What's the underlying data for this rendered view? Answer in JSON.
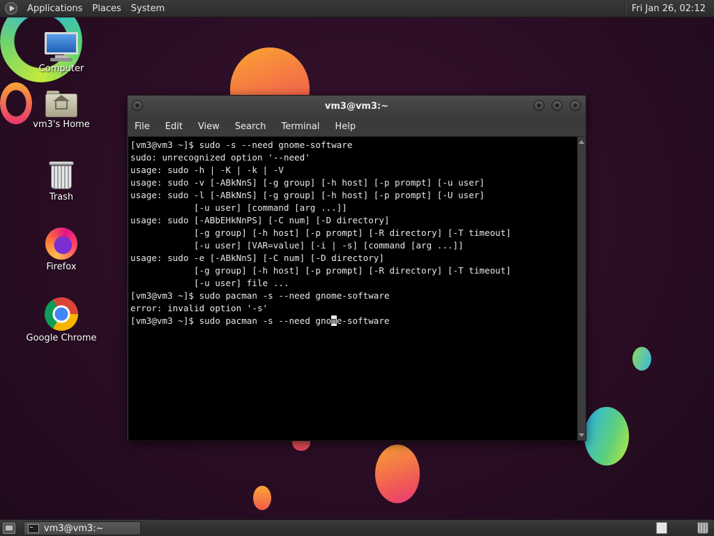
{
  "top_panel": {
    "menus": [
      "Applications",
      "Places",
      "System"
    ],
    "clock": "Fri Jan 26, 02:12"
  },
  "desktop_icons": [
    {
      "label": "Computer",
      "icon": "computer-icon"
    },
    {
      "label": "vm3's Home",
      "icon": "home-folder-icon"
    },
    {
      "label": "Trash",
      "icon": "trash-icon"
    },
    {
      "label": "Firefox",
      "icon": "firefox-icon"
    },
    {
      "label": "Google Chrome",
      "icon": "chrome-icon"
    }
  ],
  "window": {
    "title": "vm3@vm3:~",
    "menu": [
      "File",
      "Edit",
      "View",
      "Search",
      "Terminal",
      "Help"
    ]
  },
  "terminal": {
    "lines": [
      "[vm3@vm3 ~]$ sudo -s --need gnome-software",
      "sudo: unrecognized option '--need'",
      "usage: sudo -h | -K | -k | -V",
      "usage: sudo -v [-ABkNnS] [-g group] [-h host] [-p prompt] [-u user]",
      "usage: sudo -l [-ABkNnS] [-g group] [-h host] [-p prompt] [-U user]",
      "            [-u user] [command [arg ...]]",
      "usage: sudo [-ABbEHkNnPS] [-C num] [-D directory]",
      "            [-g group] [-h host] [-p prompt] [-R directory] [-T timeout]",
      "            [-u user] [VAR=value] [-i | -s] [command [arg ...]]",
      "usage: sudo -e [-ABkNnS] [-C num] [-D directory]",
      "            [-g group] [-h host] [-p prompt] [-R directory] [-T timeout]",
      "            [-u user] file ...",
      "[vm3@vm3 ~]$ sudo pacman -s --need gnome-software",
      "error: invalid option '-s'"
    ],
    "current_prompt": {
      "before_cursor": "[vm3@vm3 ~]$ sudo pacman -s --need gno",
      "cursor_char": "m",
      "after_cursor": "e-software"
    }
  },
  "taskbar": {
    "task_label": "vm3@vm3:~"
  },
  "colors": {
    "terminal_bg": "#000000",
    "terminal_fg": "#e8e8e8",
    "panel_bg": "#2b2b2b",
    "desktop_bg": "#2a0d24"
  }
}
